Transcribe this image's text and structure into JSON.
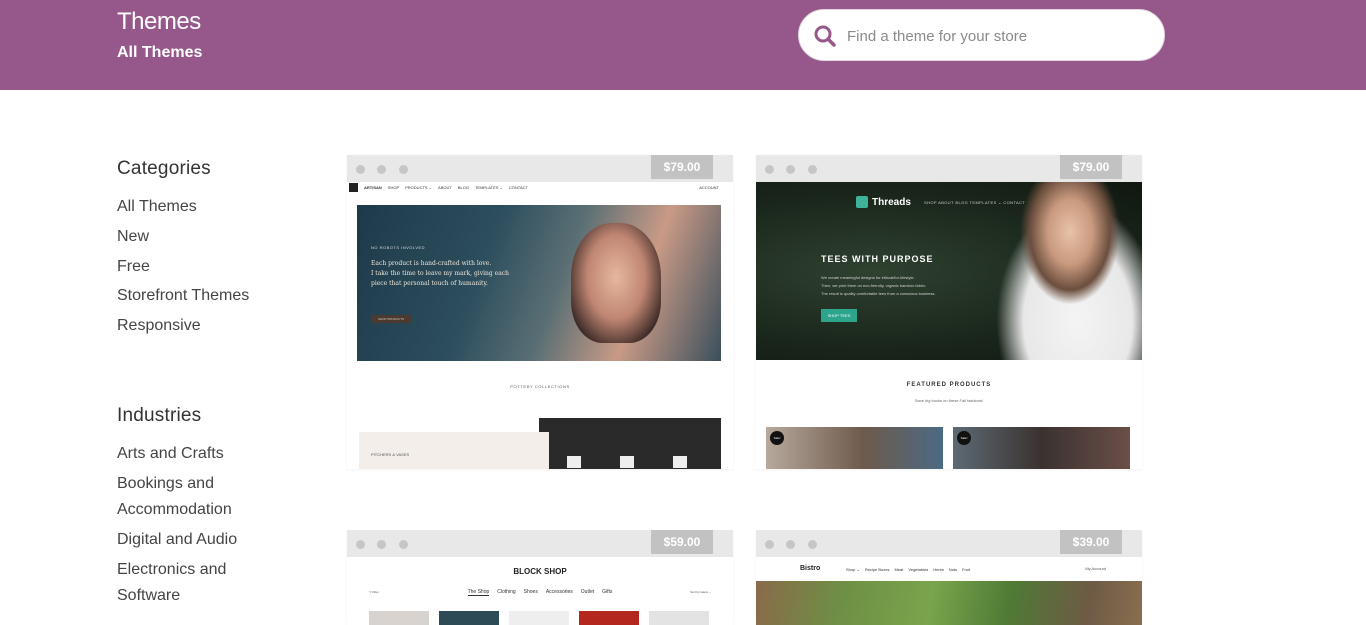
{
  "header": {
    "title": "Themes",
    "subtitle": "All Themes",
    "search_placeholder": "Find a theme for your store",
    "accent": "#96588a"
  },
  "sidebar": {
    "categories_heading": "Categories",
    "categories": [
      "All Themes",
      "New",
      "Free",
      "Storefront Themes",
      "Responsive"
    ],
    "industries_heading": "Industries",
    "industries": [
      "Arts and Crafts",
      "Bookings and",
      "Accommodation",
      "Digital and Audio",
      "Electronics and",
      "Software"
    ]
  },
  "themes": [
    {
      "price": "$79.00",
      "preview": {
        "logo": "ARTISAN",
        "nav": [
          "SHOP",
          "PRODUCTS ⌄",
          "ABOUT",
          "BLOG",
          "TEMPLATES ⌄",
          "CONTACT"
        ],
        "nav_right": "ACCOUNT",
        "kicker": "NO ROBOTS INVOLVED",
        "copy": [
          "Each product is hand-crafted with love.",
          "I take the time to leave my mark, giving each",
          "piece that personal touch of humanity."
        ],
        "button": "SHOP PRODUCTS",
        "section": "POTTERY COLLECTIONS",
        "tile": "PITCHERS & VASES"
      }
    },
    {
      "price": "$79.00",
      "preview": {
        "logo": "Threads",
        "nav": "SHOP   ABOUT   BLOG   TEMPLATES ⌄   CONTACT",
        "headline": "TEES WITH PURPOSE",
        "copy": [
          "We create meaningful designs for ethical/for-lifestyle.",
          "Then, we print them on eco-friendly, organic bamboo fabric.",
          "The result is quality comfortable tees from a conscious business."
        ],
        "button": "SHOP TEES",
        "featured": "FEATURED PRODUCTS",
        "featured_sub": "Save big bucks on these Fall fashions!",
        "sale": "Sale!"
      }
    },
    {
      "price": "$59.00",
      "preview": {
        "logo": "BLOCK SHOP",
        "nav": [
          "The Shop",
          "Clothing",
          "Shoes",
          "Accessories",
          "Outlet",
          "Gifts"
        ],
        "left": "▽ Filter",
        "right": "Sort by latest ⌄"
      }
    },
    {
      "price": "$39.00",
      "preview": {
        "logo": "Bistro",
        "nav": [
          "Shop ⌄",
          "Recipe Boxes",
          "Meat",
          "Vegetables",
          "Herbs",
          "Nuts",
          "Fruit"
        ],
        "account": "My Account"
      }
    }
  ]
}
